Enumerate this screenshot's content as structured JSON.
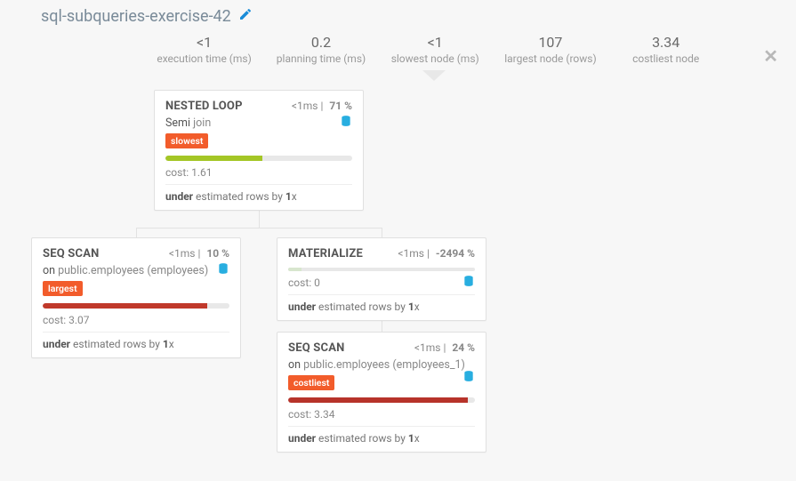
{
  "title": "sql-subqueries-exercise-42",
  "stats": {
    "exec_val": "<1",
    "exec_label": "execution time (ms)",
    "plan_val": "0.2",
    "plan_label": "planning time (ms)",
    "slow_val": "<1",
    "slow_label": "slowest node (ms)",
    "largest_val": "107",
    "largest_label": "largest node (rows)",
    "cost_val": "3.34",
    "cost_label": "costliest node"
  },
  "nodes": {
    "root": {
      "title": "NESTED LOOP",
      "time": "<1ms",
      "pct": "71 %",
      "sub_prefix": "Semi",
      "sub_rest": " join",
      "tag": "slowest",
      "cost": "cost: 1.61",
      "est_pre": "under",
      "est_mid": " estimated rows by ",
      "est_bold": "1",
      "est_suf": "x"
    },
    "left": {
      "title": "SEQ SCAN",
      "time": "<1ms",
      "pct": "10 %",
      "sub_prefix": "on",
      "sub_rest": " public.employees (employees)",
      "tag": "largest",
      "cost": "cost: 3.07",
      "est_pre": "under",
      "est_mid": " estimated rows by ",
      "est_bold": "1",
      "est_suf": "x"
    },
    "mat": {
      "title": "MATERIALIZE",
      "time": "<1ms",
      "pct": "-2494 %",
      "cost": "cost: 0",
      "est_pre": "under",
      "est_mid": " estimated rows by ",
      "est_bold": "1",
      "est_suf": "x"
    },
    "scan2": {
      "title": "SEQ SCAN",
      "time": "<1ms",
      "pct": "24 %",
      "sub_prefix": "on",
      "sub_rest": " public.employees (employees_1)",
      "tag": "costliest",
      "cost": "cost: 3.34",
      "est_pre": "under",
      "est_mid": " estimated rows by ",
      "est_bold": "1",
      "est_suf": "x"
    }
  }
}
